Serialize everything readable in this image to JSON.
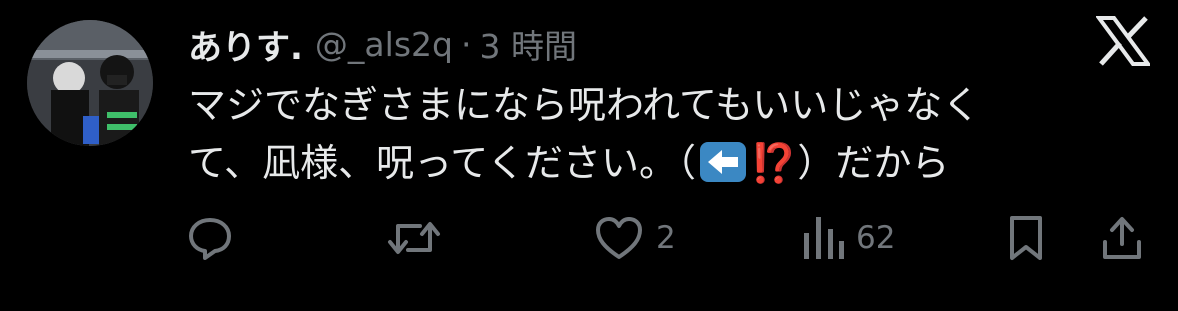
{
  "tweet": {
    "display_name": "ありす.",
    "handle": "@_als2q",
    "separator": "·",
    "time": "3 時間",
    "text_line1": "マジでなぎさまになら呪われてもいいじゃなく",
    "text_line2_a": "て、凪様、呪ってください。（",
    "text_line2_emoji_arrow": "left-arrow-emoji",
    "text_line2_interrobang": "⁉️",
    "text_line2_b": "）だから"
  },
  "actions": {
    "reply": {
      "icon": "reply-icon",
      "count": ""
    },
    "repost": {
      "icon": "repost-icon",
      "count": ""
    },
    "like": {
      "icon": "heart-icon",
      "count": "2"
    },
    "views": {
      "icon": "views-icon",
      "count": "62"
    },
    "bookmark": {
      "icon": "bookmark-icon"
    },
    "share": {
      "icon": "share-icon"
    }
  },
  "brand": {
    "logo": "x-logo-icon"
  },
  "colors": {
    "background": "#000000",
    "text_primary": "#e7e9ea",
    "text_secondary": "#71767b",
    "emoji_arrow_bg": "#3b88c3",
    "emoji_interrobang": "#e0313a"
  }
}
